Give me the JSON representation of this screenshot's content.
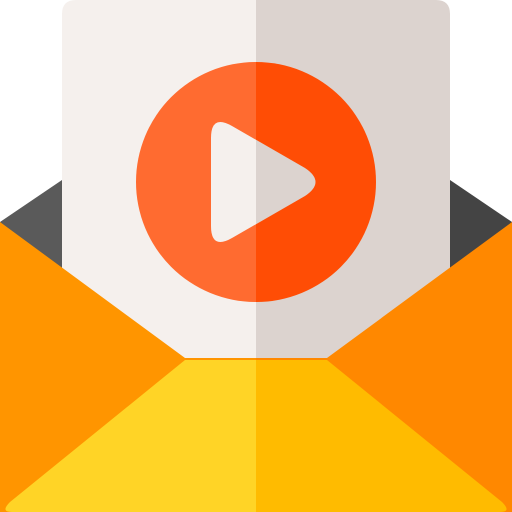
{
  "icon": {
    "name": "video-mail-icon",
    "description_parts": [
      "envelope-icon",
      "letter-sheet",
      "play-button-icon"
    ]
  },
  "colors": {
    "envelope_back_left": "#5a5a5a",
    "envelope_back_right": "#444444",
    "sheet_left": "#f5f0ed",
    "sheet_right": "#dcd3cf",
    "play_circle_left": "#ff6b30",
    "play_circle_right": "#ff4d05",
    "play_triangle_left": "#f5f0ed",
    "play_triangle_right": "#dcd3cf",
    "flap_left": "#ff9500",
    "flap_right": "#ff8800",
    "pocket_left": "#ffd426",
    "pocket_right": "#ffbb00"
  }
}
